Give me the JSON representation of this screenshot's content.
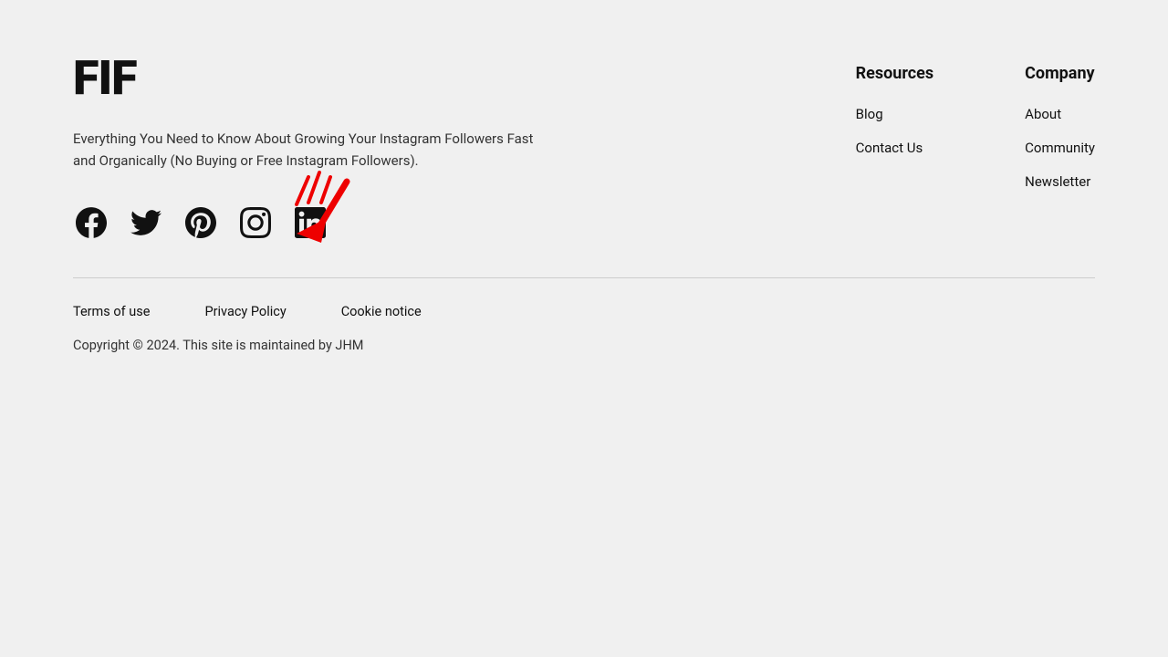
{
  "footer": {
    "logo": "FIF",
    "description": "Everything You Need to Know About Growing Your Instagram Followers Fast and Organically (No Buying or Free Instagram Followers).",
    "social": {
      "facebook_label": "Facebook",
      "twitter_label": "Twitter",
      "pinterest_label": "Pinterest",
      "instagram_label": "Instagram",
      "linkedin_label": "LinkedIn"
    },
    "resources": {
      "heading": "Resources",
      "items": [
        {
          "label": "Blog"
        },
        {
          "label": "Contact Us"
        }
      ]
    },
    "company": {
      "heading": "Company",
      "items": [
        {
          "label": "About"
        },
        {
          "label": "Community"
        },
        {
          "label": "Newsletter"
        }
      ]
    },
    "legal": {
      "terms": "Terms of use",
      "privacy": "Privacy Policy",
      "cookie": "Cookie notice"
    },
    "copyright": "Copyright © 2024. This site is maintained by JHM"
  }
}
